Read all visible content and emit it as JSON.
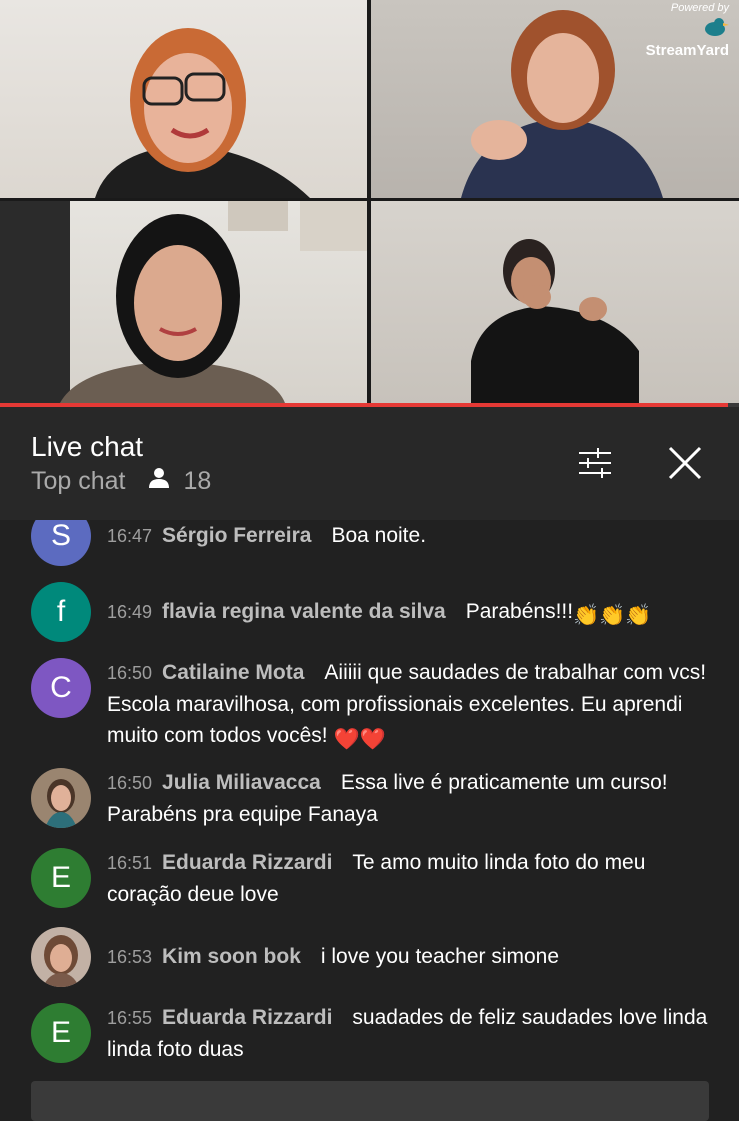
{
  "brand": {
    "powered_by": "Powered by",
    "name": "StreamYard"
  },
  "stream": {
    "progress": 0.985
  },
  "chat_header": {
    "title": "Live chat",
    "mode": "Top chat",
    "viewer_count": "18",
    "filter_icon": "tune-icon",
    "close_icon": "close-icon"
  },
  "messages": [
    {
      "initial": "S",
      "avatar_color": "#5c6bc0",
      "time": "16:47",
      "author": "Sérgio Ferreira",
      "text": "Boa noite.",
      "emoji": ""
    },
    {
      "initial": "f",
      "avatar_color": "#00897b",
      "time": "16:49",
      "author": "flavia regina valente da silva",
      "text": "Parabéns!!!",
      "emoji": "👏👏👏"
    },
    {
      "initial": "C",
      "avatar_color": "#7e57c2",
      "time": "16:50",
      "author": "Catilaine Mota",
      "text": "Aiiiii que saudades de trabalhar com vcs! Escola maravilhosa, com profissionais excelentes. Eu aprendi muito com todos vocês!",
      "emoji": "❤️❤️"
    },
    {
      "initial": "",
      "avatar_color": "#8d6e63",
      "time": "16:50",
      "author": "Julia Miliavacca",
      "text": "Essa live é praticamente um curso! Parabéns pra equipe Fanaya",
      "emoji": ""
    },
    {
      "initial": "E",
      "avatar_color": "#2e7d32",
      "time": "16:51",
      "author": "Eduarda Rizzardi",
      "text": "Te amo muito linda foto do meu coração deue love",
      "emoji": ""
    },
    {
      "initial": "",
      "avatar_color": "#a1887f",
      "time": "16:53",
      "author": "Kim soon bok",
      "text": "i love you teacher simone",
      "emoji": ""
    },
    {
      "initial": "E",
      "avatar_color": "#2e7d32",
      "time": "16:55",
      "author": "Eduarda Rizzardi",
      "text": "suadades de feliz saudades love linda linda foto duas",
      "emoji": ""
    }
  ]
}
